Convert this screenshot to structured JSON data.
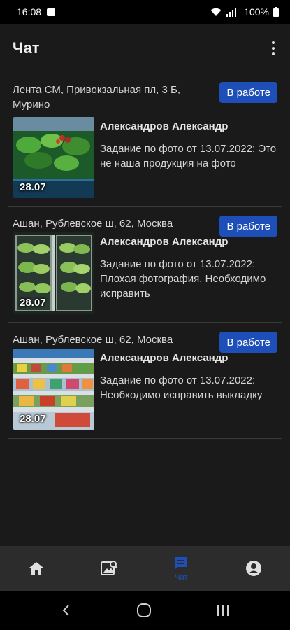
{
  "status_bar": {
    "time": "16:08",
    "battery": "100%",
    "icons": [
      "image-icon",
      "wifi-icon",
      "signal-icon",
      "battery-icon"
    ]
  },
  "app_bar": {
    "title": "Чат",
    "menu_icon": "more-vert-icon"
  },
  "colors": {
    "background": "#1a1a1a",
    "accent": "#1e4fb8",
    "divider": "#3a3a3a",
    "nav_background": "#2c2c2c"
  },
  "cards": [
    {
      "address": "Лента СМ, Привокзальная пл, 3 Б, Мурино",
      "status": "В работе",
      "thumb_date": "28.07",
      "author": "Александров Александр",
      "message": "Задание по фото от 13.07.2022: Это не наша продукция на фото"
    },
    {
      "address": "Ашан, Рублевское ш, 62, Москва",
      "status": "В работе",
      "thumb_date": "28.07",
      "author": "Александров Александр",
      "message": "Задание по фото от 13.07.2022: Плохая фотография. Необходимо исправить"
    },
    {
      "address": "Ашан, Рублевское ш, 62, Москва",
      "status": "В работе",
      "thumb_date": "28.07",
      "author": "Александров Александр",
      "message": "Задание по фото от 13.07.2022: Необходимо исправить выкладку"
    }
  ],
  "bottom_nav": {
    "items": [
      {
        "icon": "home-icon",
        "label": ""
      },
      {
        "icon": "photo-search-icon",
        "label": ""
      },
      {
        "icon": "chat-icon",
        "label": "Чат",
        "active": true
      },
      {
        "icon": "account-icon",
        "label": ""
      }
    ]
  },
  "system_nav": [
    "back-icon",
    "home-circle-icon",
    "recents-icon"
  ]
}
